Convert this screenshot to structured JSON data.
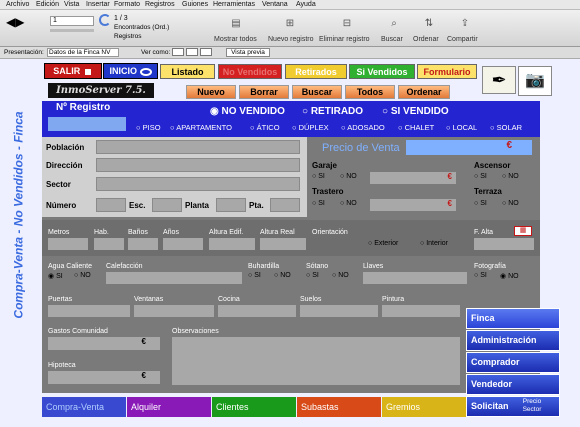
{
  "menu": [
    "Archivo",
    "Edición",
    "Vista",
    "Insertar",
    "Formato",
    "Registros",
    "Guiones",
    "Herramientas",
    "Ventana",
    "Ayuda"
  ],
  "toolbar": {
    "record_value": "1",
    "record_count": "1 / 3",
    "found": "Encontrados (Ord.)",
    "registros": "Registros",
    "mostrar": "Mostrar todos",
    "nuevo": "Nuevo registro",
    "eliminar": "Eliminar registro",
    "buscar": "Buscar",
    "ordenar": "Ordenar",
    "compartir": "Compartir"
  },
  "presbar": {
    "presentacion": "Presentación:",
    "layout": "Datos de la Finca NV",
    "ver_como": "Ver como:",
    "vista_previa": "Vista previa"
  },
  "side_title": "Compra-Venta - No Vendidos - Finca",
  "buttons": {
    "salir": "SALIR",
    "inicio": "INICIO"
  },
  "tabs": [
    "Listado",
    "No Vendidos",
    "Retirados",
    "Si Vendidos",
    "Formulario"
  ],
  "logo": "InmoServer 7.5.",
  "nav": [
    "Nuevo",
    "Borrar",
    "Buscar",
    "Todos",
    "Ordenar"
  ],
  "registro": {
    "label": "Nº Registro",
    "status": [
      "NO VENDIDO",
      "RETIRADO",
      "SI VENDIDO"
    ],
    "selected": "NO VENDIDO",
    "types": [
      "PISO",
      "APARTAMENTO",
      "ÁTICO",
      "DÚPLEX",
      "ADOSADO",
      "CHALET",
      "LOCAL",
      "SOLAR"
    ]
  },
  "labels": {
    "poblacion": "Población",
    "direccion": "Dirección",
    "sector": "Sector",
    "numero": "Número",
    "esc": "Esc.",
    "planta": "Planta",
    "pta": "Pta.",
    "precio": "Precio de Venta",
    "euro": "€",
    "garaje": "Garaje",
    "trastero": "Trastero",
    "ascensor": "Ascensor",
    "terraza": "Terraza",
    "si": "SI",
    "no": "NO",
    "metros": "Metros",
    "hab": "Hab.",
    "banos": "Baños",
    "anos": "Años",
    "altura_edif": "Altura Edif.",
    "altura_real": "Altura Real",
    "orientacion": "Orientación",
    "exterior": "Exterior",
    "interior": "Interior",
    "f_alta": "F. Alta",
    "agua": "Agua Caliente",
    "calefaccion": "Calefacción",
    "buhardilla": "Buhardilla",
    "sotano": "Sótano",
    "llaves": "Llaves",
    "fotografia": "Fotografía",
    "puertas": "Puertas",
    "ventanas": "Ventanas",
    "cocina": "Cocina",
    "suelos": "Suelos",
    "pintura": "Pintura",
    "gastos": "Gastos Comunidad",
    "observaciones": "Observaciones",
    "hipoteca": "Hipoteca"
  },
  "right_menu": [
    "Finca",
    "Administración",
    "Comprador",
    "Vendedor",
    "Solicitan"
  ],
  "precio_sector": "Precio Sector",
  "bottom_tabs": [
    "Compra-Venta",
    "Alquiler",
    "Clientes",
    "Subastas",
    "Gremios"
  ]
}
